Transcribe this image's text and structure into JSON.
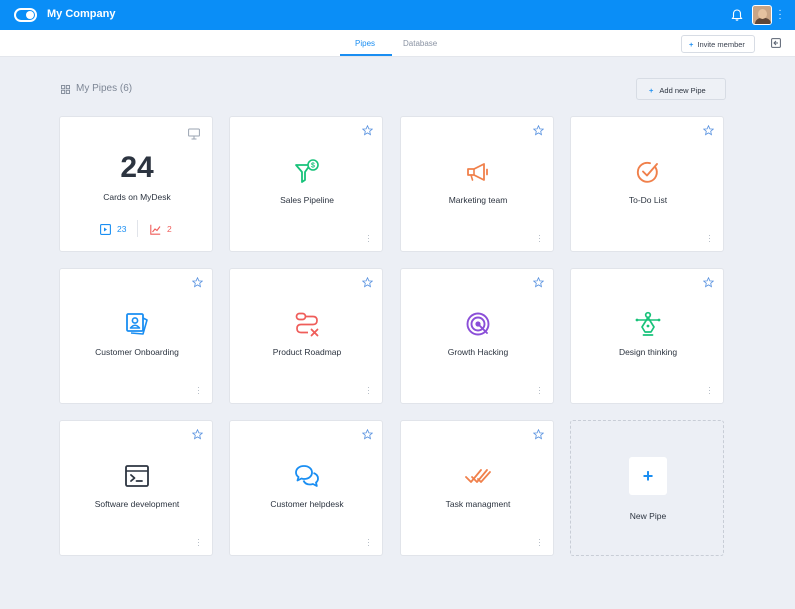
{
  "header": {
    "company": "My Company"
  },
  "subnav": {
    "tabs": [
      {
        "label": "Pipes",
        "active": true
      },
      {
        "label": "Database",
        "active": false
      }
    ],
    "invite_label": "Invite member"
  },
  "main": {
    "title": "My Pipes (6)",
    "add_label": "Add new Pipe",
    "summary": {
      "count": "24",
      "label": "Cards on MyDesk",
      "stat_a": "23",
      "stat_b": "2"
    },
    "pipes": [
      {
        "name": "Sales Pipeline",
        "icon": "funnel-dollar-icon",
        "color": "#18c27a"
      },
      {
        "name": "Marketing team",
        "icon": "megaphone-icon",
        "color": "#f0804b"
      },
      {
        "name": "To-Do List",
        "icon": "check-circle-icon",
        "color": "#f0804b"
      },
      {
        "name": "Customer Onboarding",
        "icon": "id-card-icon",
        "color": "#1a8ef2"
      },
      {
        "name": "Product Roadmap",
        "icon": "route-icon",
        "color": "#ef5d5a"
      },
      {
        "name": "Growth Hacking",
        "icon": "target-icon",
        "color": "#8b4fd8"
      },
      {
        "name": "Design thinking",
        "icon": "pen-nib-icon",
        "color": "#18c27a"
      },
      {
        "name": "Software development",
        "icon": "terminal-icon",
        "color": "#2c3440"
      },
      {
        "name": "Customer helpdesk",
        "icon": "chat-bubbles-icon",
        "color": "#1a8ef2"
      },
      {
        "name": "Task managment",
        "icon": "double-check-icon",
        "color": "#f0804b"
      }
    ],
    "new_pipe_label": "New Pipe"
  },
  "colors": {
    "brand": "#0a8ef7",
    "accent": "#1a8ef2",
    "danger": "#ef5d5a"
  }
}
